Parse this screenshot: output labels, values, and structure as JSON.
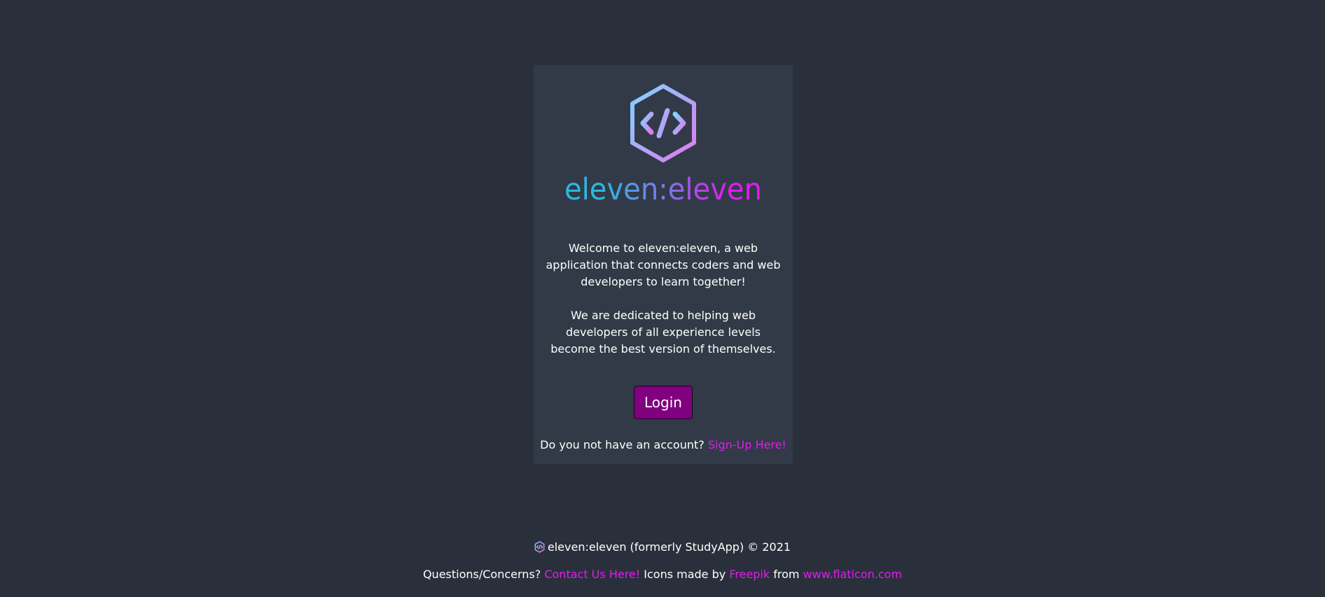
{
  "brand": {
    "name": "eleven:eleven",
    "logo_icon": "hexagon-code-icon",
    "gradient_start": "#2bb8e0",
    "gradient_mid": "#7a7ae8",
    "gradient_end": "#e01cf0"
  },
  "card": {
    "intro": "Welcome to eleven:eleven, a web application that connects coders and web developers to learn together!",
    "mission": "We are dedicated to helping web developers of all experience levels become the best version of themselves.",
    "login_label": "Login",
    "signup_prompt": "Do you not have an account?",
    "signup_link": "Sign-Up Here!"
  },
  "footer": {
    "copyright": "eleven:eleven (formerly StudyApp) © 2021",
    "questions": "Questions/Concerns?",
    "contact_link": "Contact Us Here!",
    "icons_made_by": "Icons made by",
    "freepik_link": "Freepik",
    "from_text": "from",
    "flaticon_link": "www.flaticon.com"
  },
  "colors": {
    "background": "#2a303b",
    "card": "#323a47",
    "button": "#800080",
    "link": "#e11cf0"
  }
}
